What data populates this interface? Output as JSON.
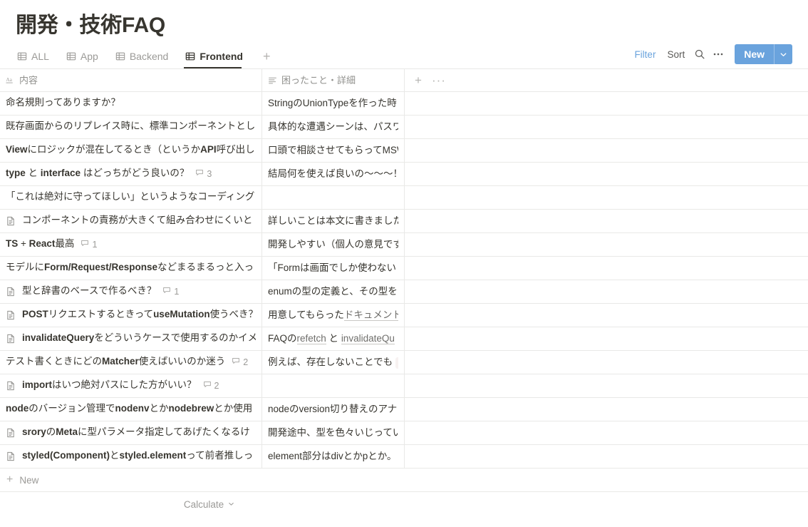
{
  "page": {
    "title": "開発・技術FAQ"
  },
  "tabs": {
    "items": [
      {
        "label": "ALL",
        "icon": "table-grid-icon",
        "active": false
      },
      {
        "label": "App",
        "icon": "table-grid-icon",
        "active": false
      },
      {
        "label": "Backend",
        "icon": "table-grid-icon",
        "active": false
      },
      {
        "label": "Frontend",
        "icon": "table-grid-icon",
        "active": true
      }
    ],
    "add_label": "+"
  },
  "toolbar": {
    "filter_label": "Filter",
    "sort_label": "Sort",
    "search_icon": "search-icon",
    "more_icon": "more-horizontal-icon",
    "new_label": "New",
    "new_caret_icon": "chevron-down-icon",
    "accent_color": "#6aa3dd"
  },
  "table": {
    "columns": [
      {
        "name": "内容",
        "icon": "title-text-icon"
      },
      {
        "name": "困ったこと・詳細",
        "icon": "multiline-text-icon"
      }
    ],
    "add_column_icon": "plus-icon",
    "column_menu_icon": "more-horizontal-icon",
    "rows": [
      {
        "has_doc_icon": false,
        "title": "命名規則ってありますか？",
        "title_bold": "",
        "comments": null,
        "detail": "StringのUnionTypeを作った時"
      },
      {
        "has_doc_icon": false,
        "title": "既存画面からのリプレイス時に、標準コンポーネントとし",
        "comments": null,
        "detail": "具体的な遭遇シーンは、パスワ"
      },
      {
        "has_doc_icon": false,
        "title": "Viewにロジックが混在してるとき（というかAPI呼び出し",
        "comments": null,
        "detail": "口頭で相談させてもらってMSW"
      },
      {
        "has_doc_icon": false,
        "title": "type と interface はどっちがどう良いの？",
        "comments": "3",
        "detail": "結局何を使えば良いの〜〜〜！"
      },
      {
        "has_doc_icon": false,
        "title": "「これは絶対に守ってほしい」というようなコーディング",
        "comments": null,
        "detail": ""
      },
      {
        "has_doc_icon": true,
        "title": "コンポーネントの責務が大きくて組み合わせにくいと",
        "comments": null,
        "detail": "詳しいことは本文に書きました"
      },
      {
        "has_doc_icon": false,
        "title": "TS + React最高",
        "comments": "1",
        "detail": "開発しやすい（個人の意見です"
      },
      {
        "has_doc_icon": false,
        "title": "モデルにForm/Request/Responseなどまるまるっと入っ",
        "comments": null,
        "detail": "「Formは画面でしか使わない"
      },
      {
        "has_doc_icon": true,
        "title": "型と辞書のベースで作るべき？",
        "comments": "1",
        "detail": "enumの型の定義と、その型を"
      },
      {
        "has_doc_icon": true,
        "title": "POSTリクエストするときってuseMutation使うべき？",
        "comments": null,
        "detail": "用意してもらったドキュメント"
      },
      {
        "has_doc_icon": true,
        "title": "invalidateQueryをどういうケースで使用するのかイメ",
        "comments": null,
        "detail": "FAQのrefetch と invalidateQu"
      },
      {
        "has_doc_icon": false,
        "title": "テスト書くときにどのMatcher使えばいいのか迷う",
        "comments": "2",
        "detail": "例えば、存在しないことでも t"
      },
      {
        "has_doc_icon": true,
        "title": "importはいつ絶対パスにした方がいい？",
        "comments": "2",
        "detail": ""
      },
      {
        "has_doc_icon": false,
        "title": "nodeのバージョン管理でnodenvとかnodebrewとか使用",
        "comments": null,
        "detail": "nodeのversion切り替えのアナ"
      },
      {
        "has_doc_icon": true,
        "title": "sroryのMetaに型パラメータ指定してあげたくなるけ",
        "comments": null,
        "detail": "開発途中、型を色々いじってい"
      },
      {
        "has_doc_icon": true,
        "title": "styled(Component)とstyled.elementって前者推しっ",
        "comments": null,
        "detail": "element部分はdivとかpとか。"
      }
    ],
    "new_row_label": "New",
    "new_row_icon": "plus-icon",
    "calculate_label": "Calculate",
    "calculate_icon": "chevron-down-icon"
  }
}
